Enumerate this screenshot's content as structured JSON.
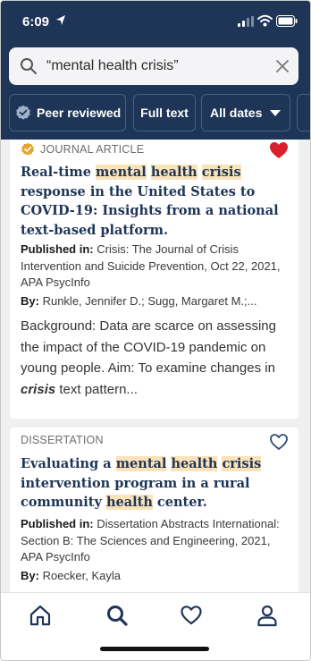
{
  "status_bar": {
    "time": "6:09"
  },
  "search": {
    "query": "“mental health crisis”"
  },
  "filters": {
    "peer_reviewed": "Peer reviewed",
    "full_text": "Full text",
    "dates": "All dates"
  },
  "results": [
    {
      "type": "JOURNAL ARTICLE",
      "favorited": true,
      "title_parts": [
        "Real-time ",
        "mental",
        " ",
        "health",
        " ",
        "crisis",
        " response in the United States to COVID-19: Insights from a national text-based platform."
      ],
      "published_label": "Published in:",
      "published": "Crisis: The Journal of Crisis Intervention and Suicide Prevention, Oct 22, 2021, APA PsycInfo",
      "by_label": "By:",
      "authors": "Runkle, Jennifer D.; Sugg, Margaret M.;...",
      "abstract_parts": [
        "Background: Data are scarce on assessing the impact of the COVID-19 pandemic on young people. Aim: To examine changes in ",
        "crisis",
        " text pattern..."
      ]
    },
    {
      "type": "DISSERTATION",
      "favorited": false,
      "title_parts": [
        "Evaluating a ",
        "mental",
        " ",
        "health",
        " ",
        "crisis",
        " intervention program in a rural community ",
        "health",
        " center."
      ],
      "published_label": "Published in:",
      "published": "Dissertation Abstracts International: Section B: The Sciences and Engineering, 2021, APA PsycInfo",
      "by_label": "By:",
      "authors": "Roecker, Kayla"
    }
  ],
  "colors": {
    "header": "#1e3557",
    "highlight": "#fbe3b9",
    "favorite": "#d9202c",
    "badge": "#e3a72f"
  }
}
